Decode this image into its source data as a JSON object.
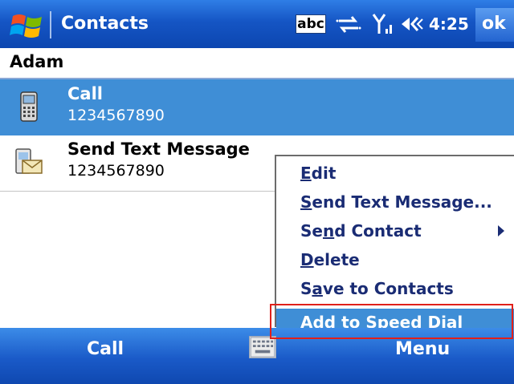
{
  "titlebar": {
    "app_title": "Contacts",
    "start_icon": "windows-flag-icon",
    "input_indicator": "abc",
    "time": "4:25",
    "ok_label": "ok",
    "icons": [
      "connectivity-icon",
      "signal-strength-icon",
      "volume-icon"
    ]
  },
  "contact": {
    "name": "Adam"
  },
  "rows": [
    {
      "label": "Call",
      "number": "1234567890",
      "icon": "mobile-phone-icon",
      "selected": true
    },
    {
      "label": "Send Text Message",
      "number": "1234567890",
      "icon": "text-message-icon",
      "selected": false
    }
  ],
  "context_menu": {
    "items": [
      {
        "label": "Edit",
        "mnemonic_index": 0
      },
      {
        "label": "Send Text Message...",
        "mnemonic_index": 0
      },
      {
        "label": "Send Contact",
        "mnemonic_index": 2,
        "has_submenu": true
      },
      {
        "label": "Delete",
        "mnemonic_index": 0
      },
      {
        "label": "Save to Contacts",
        "mnemonic_index": 1
      },
      {
        "label": "Add to Speed Dial",
        "mnemonic_index": 4,
        "highlighted": true
      }
    ]
  },
  "softkeys": {
    "left": "Call",
    "right": "Menu",
    "keyboard_icon": "keyboard-icon"
  },
  "colors": {
    "titlebar": "#1555c4",
    "selection": "#3f8ed6",
    "menu_text": "#1a2c74",
    "annotation": "#e0201a"
  }
}
